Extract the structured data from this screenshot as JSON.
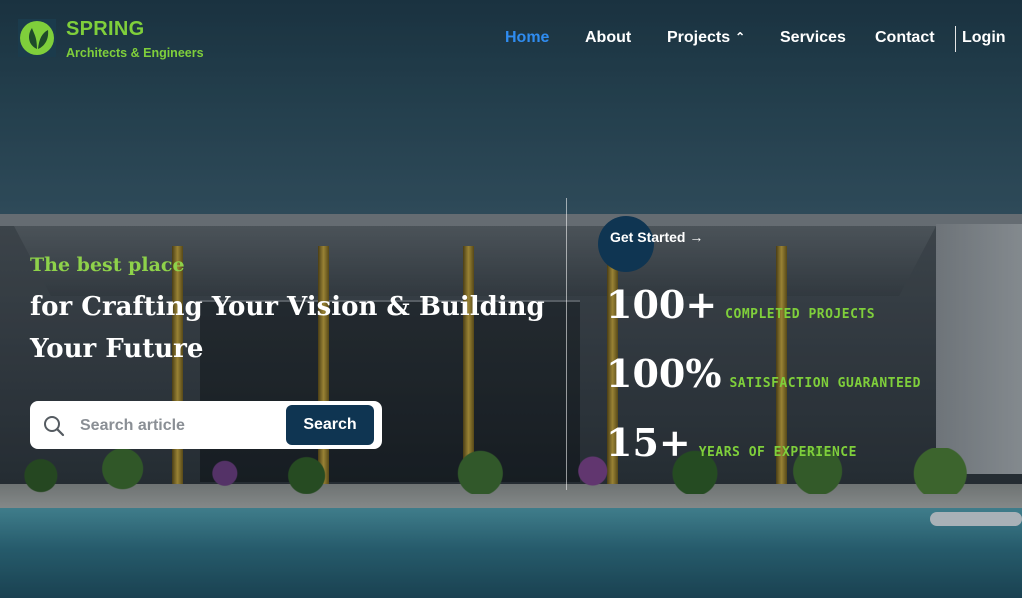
{
  "brand": {
    "name": "SPRING",
    "tagline": "Architects & Engineers",
    "color": "#7fcf3b"
  },
  "nav": {
    "items": [
      {
        "label": "Home",
        "active": true
      },
      {
        "label": "About"
      },
      {
        "label": "Projects",
        "icon": "chevron-up-icon"
      },
      {
        "label": "Services"
      },
      {
        "label": "Contact"
      }
    ],
    "login_label": "Login",
    "active_color": "#2f8cf0"
  },
  "hero": {
    "tagline": "The best place",
    "headline": "for Crafting Your Vision & Building Your Future"
  },
  "search": {
    "placeholder": "Search article",
    "value": "",
    "button_label": "Search",
    "icon": "search-icon"
  },
  "cta": {
    "label": "Get Started →"
  },
  "stats": [
    {
      "number": "100+",
      "label": "COMPLETED PROJECTS"
    },
    {
      "number": "100%",
      "label": "SATISFACTION GUARANTEED"
    },
    {
      "number": "15+",
      "label": "YEARS OF EXPERIENCE"
    }
  ],
  "colors": {
    "primary_dark": "#0f3552",
    "accent_green": "#7fcf3b"
  }
}
